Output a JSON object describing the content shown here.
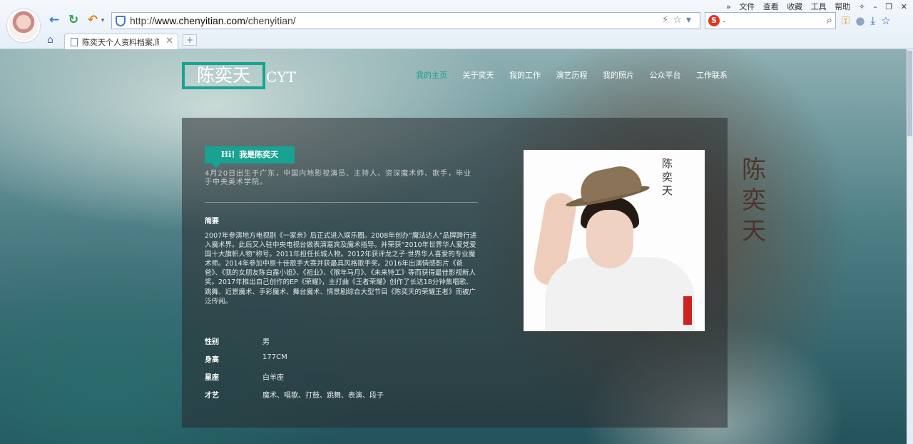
{
  "browser": {
    "menu": [
      "»",
      "文件",
      "查看",
      "收藏",
      "工具",
      "帮助"
    ],
    "url_prefix": "http://",
    "url_domain": "www.chenyitian.com",
    "url_path": "/chenyitian/",
    "search_value": ".",
    "search_logo": "S",
    "tab_title": "陈奕天个人资料档案,陈奕",
    "new_tab": "+",
    "icons": [
      "back-icon",
      "refresh-icon",
      "undo-icon",
      "home-icon",
      "shield-icon",
      "lightning-icon",
      "star-icon",
      "search-icon",
      "key-icon",
      "chat-icon",
      "download-icon",
      "favorite-icon"
    ]
  },
  "site": {
    "logo": "陈奕天",
    "logo_suffix": "CYT",
    "nav": [
      "我的主页",
      "关于奕天",
      "我的工作",
      "演艺历程",
      "我的照片",
      "公众平台",
      "工作联系"
    ],
    "active_nav": 0,
    "calligraphy": "陈奕天",
    "accent_color": "#18a291"
  },
  "profile": {
    "hi": "Hi！我是陈奕天",
    "intro": "4月20日出生于广东，中国内地影视演员、主持人、资深魔术师、歌手，毕业于中央美术学院。",
    "summary_label": "简要",
    "summary": "2007年参演地方电视剧《一家亲》后正式进入娱乐圈。2008年创办“魔法达人”品牌跨行进入魔术界。此后又入驻中央电视台做表演嘉宾及魔术指导。并荣获“2010年世界华人爱党爱国十大旗帜人物”称号。2011年担任长城人物。2012年获评龙之子·世界华人喜爱的专业魔术师。2014年参加中原十佳歌手大赛并获最具风格歌手奖。2016年出演情感影片《爸爸》、《我的女朋友陈白露小姐》、《祖业》、《猴年马月》、《未来特工》等而获得最佳影视新人奖。2017年推出自己创作的EP《荣耀》，主打曲《王者荣耀》创作了长达18分钟集唱歌、跳舞、近景魔术、手彩魔术、舞台魔术、情景剧综合大型节目《陈奕天的荣耀王者》而被广泛传阅。",
    "facts": [
      {
        "label": "性别",
        "value": "男"
      },
      {
        "label": "身高",
        "value": "177CM"
      },
      {
        "label": "星座",
        "value": "白羊座"
      },
      {
        "label": "才艺",
        "value": "魔术、唱歌、打鼓、跳舞、表演、段子"
      }
    ],
    "photo_ink": "陈奕天"
  }
}
